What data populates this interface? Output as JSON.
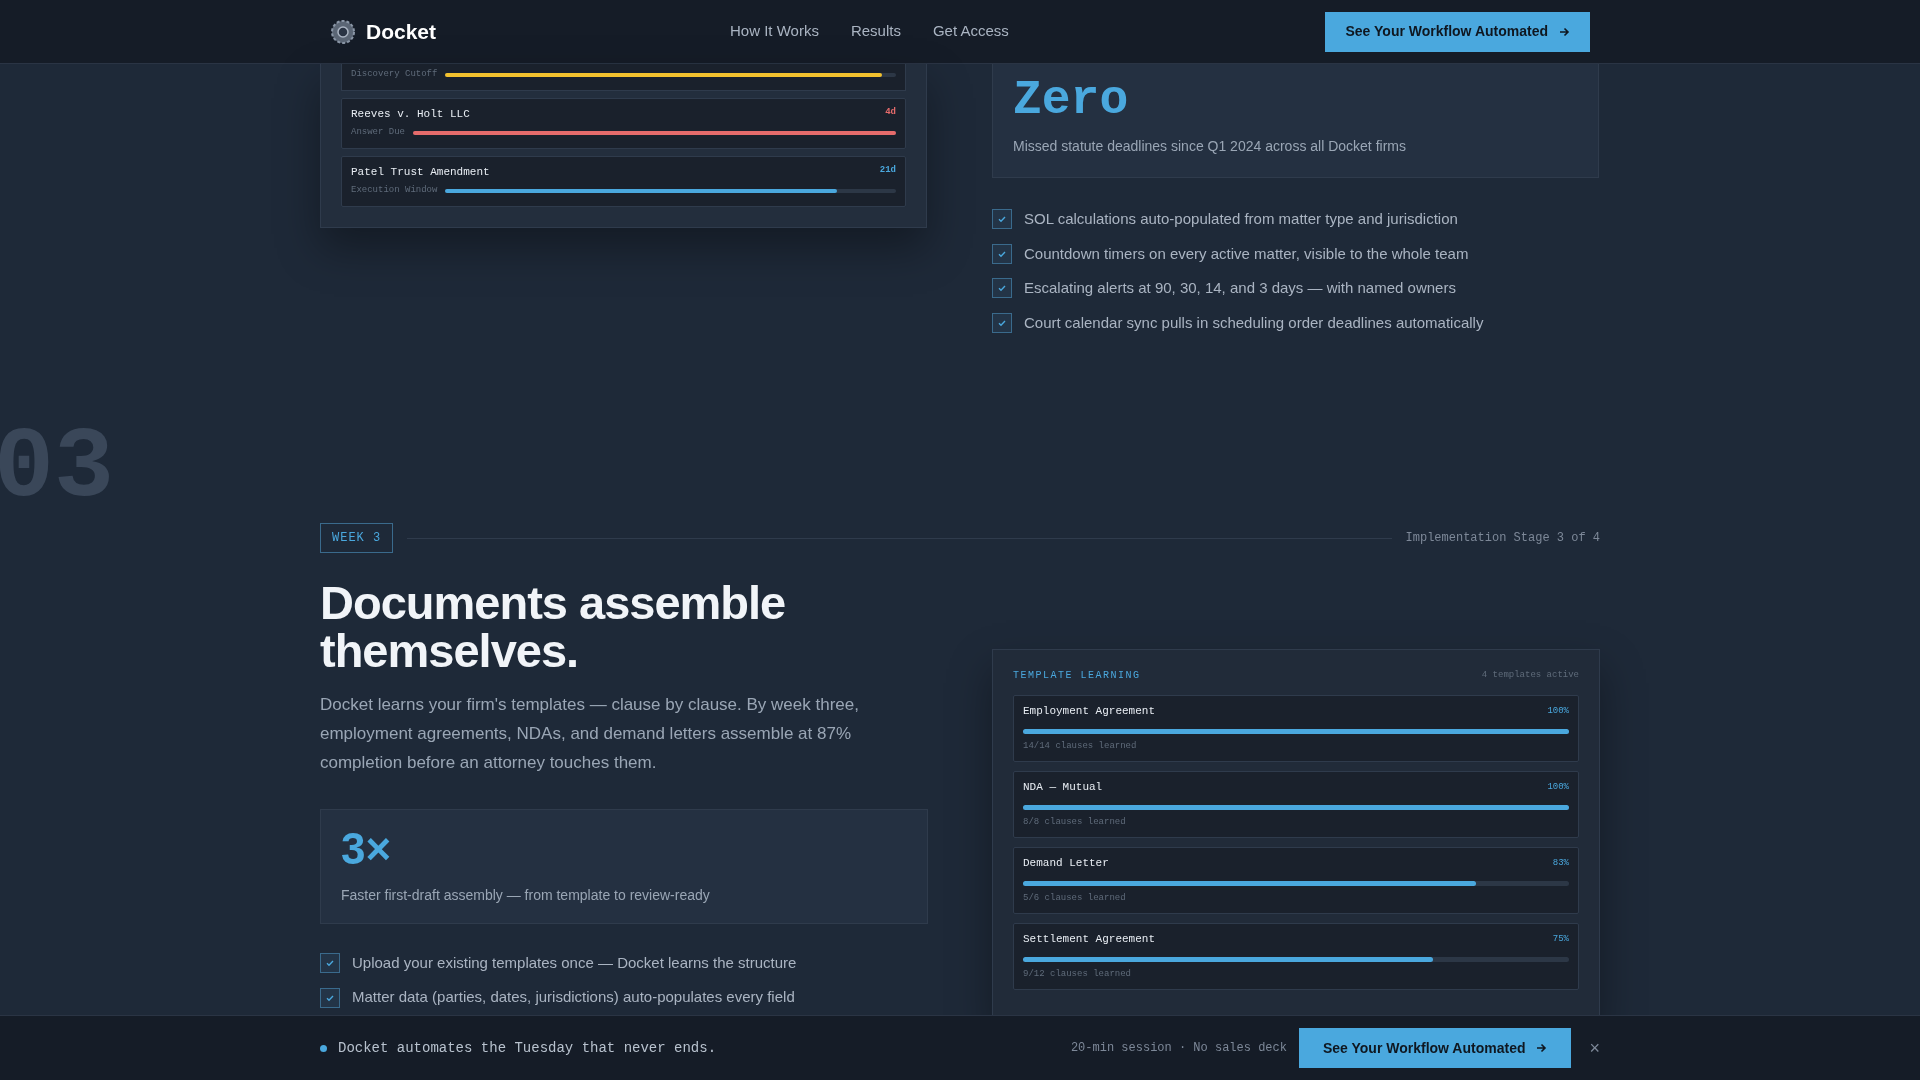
{
  "header": {
    "brand": "Docket",
    "nav": [
      "How It Works",
      "Results",
      "Get Access"
    ],
    "cta": "See Your Workflow Automated"
  },
  "deadlines": [
    {
      "sub": "Discovery Cutoff",
      "level": 0.97,
      "color": "#f2c12e"
    },
    {
      "title": "Reeves v. Holt LLC",
      "days": "4d",
      "sub": "Answer Due",
      "level": 1,
      "color": "#e56b6b"
    },
    {
      "title": "Patel Trust Amendment",
      "days": "21d",
      "sub": "Execution Window",
      "level": 0.87,
      "color": "#4aa8de"
    }
  ],
  "stat_top": {
    "value": "Zero",
    "caption": "Missed statute deadlines since Q1 2024 across all Docket firms"
  },
  "checklist_top": [
    {
      "text": "SOL calculations auto-populated from matter type and jurisdiction",
      "checked": true
    },
    {
      "text": "Countdown timers on every active matter, visible to the whole team",
      "checked": true
    },
    {
      "text": "Escalating alerts at 90, 30, 14, and 3 days — with named owners",
      "checked": true
    },
    {
      "text": "Court calendar sync pulls in scheduling order deadlines automatically",
      "checked": true
    }
  ],
  "section_number": "03",
  "week": {
    "badge": "WEEK 3",
    "stage": "Implementation Stage 3 of 4"
  },
  "heading": "Documents assemble themselves.",
  "body": "Docket learns your firm's templates — clause by clause. By week three, employment agreements, NDAs, and demand letters assemble at 87% completion before an attorney touches them.",
  "stat": {
    "value": "3×",
    "caption": "Faster first-draft assembly — from template to review-ready"
  },
  "checklist": [
    {
      "text": "Upload your existing templates once — Docket learns the structure",
      "checked": true
    },
    {
      "text": "Matter data (parties, dates, jurisdictions) auto-populates every field",
      "checked": true
    }
  ],
  "templates": {
    "title": "TEMPLATE LEARNING",
    "count": "4 templates active",
    "items": [
      {
        "name": "Employment Agreement",
        "percent": "100%",
        "level": 1,
        "note": "14/14 clauses learned"
      },
      {
        "name": "NDA — Mutual",
        "percent": "100%",
        "level": 1,
        "note": "8/8 clauses learned"
      },
      {
        "name": "Demand Letter",
        "percent": "83%",
        "level": 0.83,
        "note": "5/6 clauses learned"
      },
      {
        "name": "Settlement Agreement",
        "percent": "75%",
        "level": 0.75,
        "note": "9/12 clauses learned"
      }
    ]
  },
  "bottom_bar": {
    "tagline": "Docket automates the Tuesday that never ends.",
    "meta": "20-min session · No sales deck",
    "cta": "See Your Workflow Automated",
    "close": "×"
  }
}
